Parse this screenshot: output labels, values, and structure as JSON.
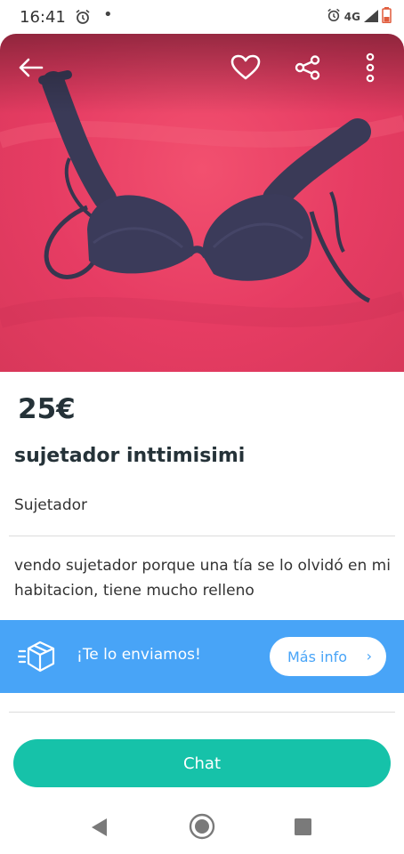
{
  "status_bar": {
    "time": "16:41",
    "dot": "•",
    "network": "4G",
    "icons": [
      "alarm-icon",
      "signal-icon",
      "battery-icon"
    ]
  },
  "header": {
    "icons": [
      "back-arrow-icon",
      "heart-icon",
      "share-icon",
      "more-vertical-icon"
    ]
  },
  "listing": {
    "price": "25€",
    "title": "sujetador inttimisimi",
    "category": "Sujetador",
    "description": "vendo sujetador porque una tía se lo olvidó en mi habitacion, tiene mucho relleno"
  },
  "shipping": {
    "text": "¡Te lo enviamos!",
    "button_label": "Más info",
    "chevron": "›",
    "icon": "box-delivery-icon"
  },
  "actions": {
    "chat_label": "Chat"
  },
  "colors": {
    "dark_text": "#253238",
    "shipping_banner": "#48a4f7",
    "chat_button": "#16c2a9",
    "photo_background": "#e63c63"
  }
}
